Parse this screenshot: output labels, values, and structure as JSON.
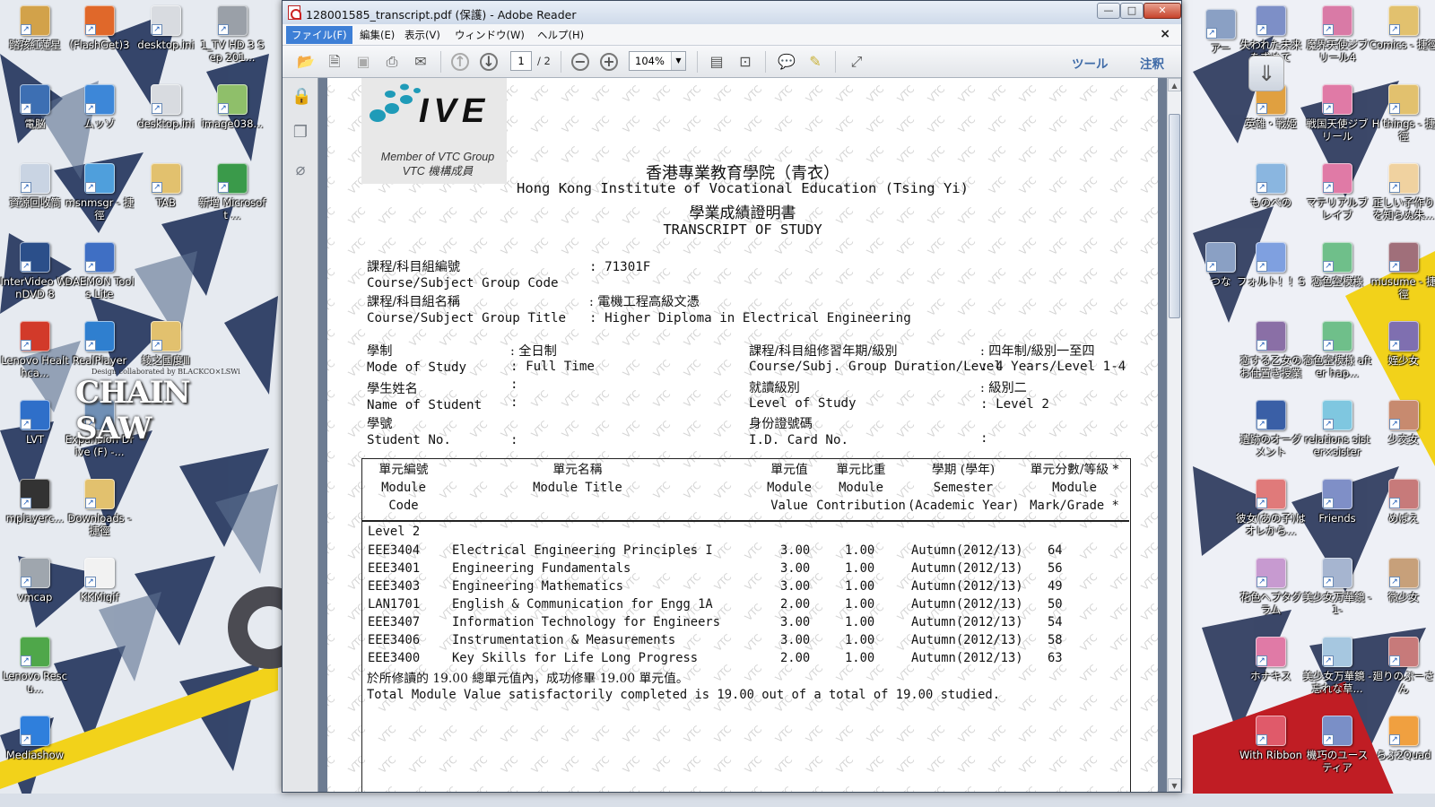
{
  "desktop": {
    "left_icons": [
      {
        "label": "踏孩紅蓮星",
        "color": "#d2a24a"
      },
      {
        "label": "(FlashGet)3",
        "color": "#e0682a"
      },
      {
        "label": "desktop.ini",
        "color": "#d8dbe0"
      },
      {
        "label": "1_TV HD 3 Sep 201...",
        "color": "#9aa0a8"
      },
      {
        "label": "電脳",
        "color": "#3d6fb3"
      },
      {
        "label": "ムッゾ",
        "color": "#3d87d8"
      },
      {
        "label": "desktop.ini",
        "color": "#d8dbe0"
      },
      {
        "label": "image038...",
        "color": "#8fbf6a"
      },
      {
        "label": "資源回收筒",
        "color": "#c9d4e3"
      },
      {
        "label": "msnmsgr - 捷徑",
        "color": "#4f9fdc"
      },
      {
        "label": "TAB",
        "color": "#e2c16e"
      },
      {
        "label": "新増 Microsoft ...",
        "color": "#3a9a4a"
      },
      {
        "label": "InterVideo WinDVD 8",
        "color": "#2b4f8a"
      },
      {
        "label": "DAEMON Tools Lite",
        "color": "#3f6fc4"
      },
      {
        "label": "Lenovo Healthca...",
        "color": "#d23a2a"
      },
      {
        "label": "RealPlayer",
        "color": "#2f7fcf"
      },
      {
        "label": "綾之國度Ⅲ",
        "color": "#e2c16e"
      },
      {
        "label": "LVT",
        "color": "#2f6fc9"
      },
      {
        "label": "Expansion Drive (F) -...",
        "color": "#6f8fb5"
      },
      {
        "label": "mplayerc...",
        "color": "#333333"
      },
      {
        "label": "Downloads - 捷徑",
        "color": "#e2c16e"
      },
      {
        "label": "vmcap",
        "color": "#9fa6ae"
      },
      {
        "label": "KKMigif",
        "color": "#f2f2f2"
      },
      {
        "label": "Lenovo Rescu...",
        "color": "#4fa74a"
      },
      {
        "label": "Mediashow",
        "color": "#2f7fdc"
      }
    ],
    "right_icons": [
      {
        "label": "アー",
        "color": "#8aa0c4"
      },
      {
        "label": "失われた未来を求めて",
        "color": "#7d8fc7"
      },
      {
        "label": "魔界天使ジブリール4",
        "color": "#d97aa6"
      },
      {
        "label": "Comics - 捷徑",
        "color": "#e2c16e"
      },
      {
        "label": "英雄・戦姫",
        "color": "#e0a040"
      },
      {
        "label": "戦国天使ジブリール",
        "color": "#e07aa6"
      },
      {
        "label": "H things - 捷徑",
        "color": "#e2c16e"
      },
      {
        "label": "ものべの",
        "color": "#8ab6e0"
      },
      {
        "label": "マテリアルブレイブ",
        "color": "#e07aa6"
      },
      {
        "label": "正しい子作りを知らぬ朱...",
        "color": "#f0d2a0"
      },
      {
        "label": "つな",
        "color": "#8aa0c4"
      },
      {
        "label": "フォルト！！S",
        "color": "#7fa0e0"
      },
      {
        "label": "恋色空模様",
        "color": "#6fbf8a"
      },
      {
        "label": "musume - 捷徑",
        "color": "#a06f7a"
      },
      {
        "label": "恋する乙女の お仕置き授業",
        "color": "#8a6fa6"
      },
      {
        "label": "恋色空模様 after hap...",
        "color": "#6fbf8a"
      },
      {
        "label": "姪少女",
        "color": "#7f6fb0"
      },
      {
        "label": "遺跡のオーグメント",
        "color": "#3a5fa6"
      },
      {
        "label": "relations sister×sister",
        "color": "#7fc7e0"
      },
      {
        "label": "少交女",
        "color": "#c78a6f"
      },
      {
        "label": "彼女(あの子)はオレから...",
        "color": "#e07a7a"
      },
      {
        "label": "Friends",
        "color": "#7f8fc7"
      },
      {
        "label": "めばえ",
        "color": "#c77a7a"
      },
      {
        "label": "花色ヘプタグラム",
        "color": "#c79ad0"
      },
      {
        "label": "美少女万華鏡 -1-",
        "color": "#a6b5d0"
      },
      {
        "label": "微少女",
        "color": "#c7a07a"
      },
      {
        "label": "ホナキス",
        "color": "#e07aa6"
      },
      {
        "label": "美少女万華鏡 -忘れな草...",
        "color": "#a6c7e0"
      },
      {
        "label": "廻りのぷーさん",
        "color": "#c77a7a"
      },
      {
        "label": "With Ribbon",
        "color": "#e05a6a"
      },
      {
        "label": "機巧のユースティア",
        "color": "#7a8fc7"
      },
      {
        "label": "らぶ2Quad",
        "color": "#f0a040"
      }
    ],
    "chainsaw_text": "CHAIN SAW",
    "chainsaw_tag": "Design collaborated by BLACKCO×LSWi"
  },
  "window": {
    "title": "128001585_transcript.pdf (保護) - Adobe Reader",
    "min_label": "—",
    "max_label": "□",
    "close_label": "✕",
    "menu": {
      "file": "ファイル(F)",
      "edit": "編集(E)",
      "view": "表示(V)",
      "window": "ウィンドウ(W)",
      "help": "ヘルプ(H)"
    },
    "doc_close": "×",
    "toolbar": {
      "page_current": "1",
      "page_total": "/ 2",
      "zoom": "104%",
      "tools": "ツール",
      "comment": "注釈"
    }
  },
  "transcript": {
    "logo_text": "IVE",
    "logo_member_en": "Member of VTC Group",
    "logo_member_zh": "VTC 機構成員",
    "watermark_text": "VTC",
    "institute_zh": "香港專業教育學院（青衣）",
    "institute_en": "Hong Kong Institute of Vocational Education (Tsing Yi)",
    "doc_title_zh": "學業成績證明書",
    "doc_title_en": "TRANSCRIPT OF STUDY",
    "code_label_zh": "課程/科目組編號",
    "code_label_en": "Course/Subject Group Code",
    "code_value": ": 71301F",
    "title_label_zh": "課程/科目組名稱",
    "title_label_en": "Course/Subject Group Title",
    "title_value_zh": ": 電機工程高級文憑",
    "title_value_en": ": Higher Diploma in Electrical Engineering",
    "mode_label_zh": "學制",
    "mode_label_en": "Mode of Study",
    "mode_value_zh": ": 全日制",
    "mode_value_en": ": Full Time",
    "name_label_zh": "學生姓名",
    "name_label_en": "Name of Student",
    "name_colon_zh": ":",
    "name_colon_en": ":",
    "sid_label_zh": "學號",
    "sid_label_en": "Student No.",
    "sid_colon": ":",
    "duration_label_zh": "課程/科目組修習年期/級別",
    "duration_label_en": "Course/Subj. Group Duration/Level",
    "duration_value_zh": ": 四年制/級別一至四",
    "duration_value_en": ": 4 Years/Level 1-4",
    "level_label_zh": "就讀級別",
    "level_label_en": "Level of Study",
    "level_value_zh": ": 級別二",
    "level_value_en": ": Level 2",
    "id_label_zh": "身份證號碼",
    "id_label_en": "I.D. Card No.",
    "id_colon": ":",
    "table": {
      "headers": {
        "code_zh": "單元編號",
        "code_en1": "Module",
        "code_en2": "Code",
        "title_zh": "單元名稱",
        "title_en": "Module Title",
        "value_zh": "單元值",
        "value_en1": "Module",
        "value_en2": "Value",
        "contrib_zh": "單元比重",
        "contrib_en1": "Module",
        "contrib_en2": "Contribution",
        "sem_zh": "學期 (學年)",
        "sem_en1": "Semester",
        "sem_en2": "(Academic Year)",
        "mark_zh": "單元分數/等級 *",
        "mark_en1": "Module",
        "mark_en2": "Mark/Grade *"
      },
      "level_heading": "Level 2",
      "rows": [
        {
          "code": "EEE3404",
          "title": "Electrical Engineering Principles I",
          "value": "3.00",
          "contrib": "1.00",
          "semester": "Autumn(2012/13)",
          "mark": "64"
        },
        {
          "code": "EEE3401",
          "title": "Engineering Fundamentals",
          "value": "3.00",
          "contrib": "1.00",
          "semester": "Autumn(2012/13)",
          "mark": "56"
        },
        {
          "code": "EEE3403",
          "title": "Engineering Mathematics",
          "value": "3.00",
          "contrib": "1.00",
          "semester": "Autumn(2012/13)",
          "mark": "49"
        },
        {
          "code": "LAN1701",
          "title": "English & Communication for Engg 1A",
          "value": "2.00",
          "contrib": "1.00",
          "semester": "Autumn(2012/13)",
          "mark": "50"
        },
        {
          "code": "EEE3407",
          "title": "Information Technology for Engineers",
          "value": "3.00",
          "contrib": "1.00",
          "semester": "Autumn(2012/13)",
          "mark": "54"
        },
        {
          "code": "EEE3406",
          "title": "Instrumentation & Measurements",
          "value": "3.00",
          "contrib": "1.00",
          "semester": "Autumn(2012/13)",
          "mark": "58"
        },
        {
          "code": "EEE3400",
          "title": "Key Skills for Life Long Progress",
          "value": "2.00",
          "contrib": "1.00",
          "semester": "Autumn(2012/13)",
          "mark": "63"
        }
      ],
      "summary_zh": "於所修讀的 19.00 總單元值內，成功修畢 19.00 單元值。",
      "summary_en": "Total Module Value satisfactorily completed is 19.00 out of a total of 19.00 studied."
    }
  }
}
